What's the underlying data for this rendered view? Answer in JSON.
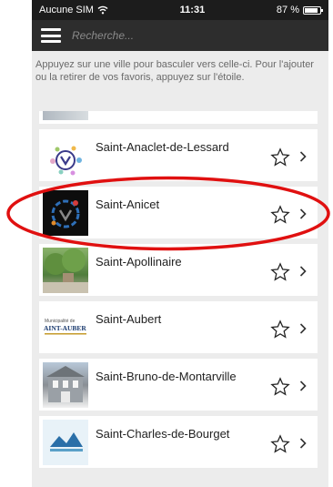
{
  "status_bar": {
    "carrier": "Aucune SIM",
    "time": "11:31",
    "battery": "87 %",
    "battery_level": 0.87
  },
  "nav": {
    "search_placeholder": "Recherche..."
  },
  "instructions": "Appuyez sur une ville pour basculer vers celle-ci. Pour l'ajouter ou la retirer de vos favoris, appuyez sur l'étoile.",
  "cities": [
    {
      "name": "Saint-Anaclet-de-Lessard"
    },
    {
      "name": "Saint-Anicet"
    },
    {
      "name": "Saint-Apollinaire"
    },
    {
      "name": "Saint-Aubert"
    },
    {
      "name": "Saint-Bruno-de-Montarville"
    },
    {
      "name": "Saint-Charles-de-Bourget"
    }
  ],
  "logos": {
    "aubert_top": "Municipalité de",
    "aubert_main": "AINT-AUBER"
  },
  "colors": {
    "nav_bar": "#2d2d2d",
    "status_bar": "#1c1c1c",
    "highlight": "#e01010",
    "list_background": "#ececec"
  },
  "icons": {
    "star": "star-outline-icon",
    "chevron": "chevron-right-icon",
    "menu": "hamburger-menu-icon",
    "wifi": "wifi-icon",
    "battery": "battery-icon"
  }
}
